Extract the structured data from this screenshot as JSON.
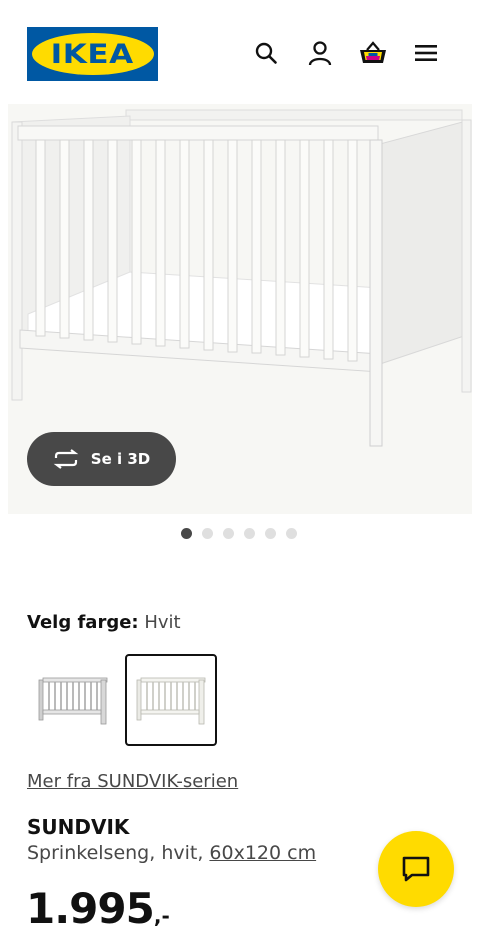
{
  "header": {
    "logo_text": "IKEA",
    "icons": [
      "search-icon",
      "user-icon",
      "basket-icon",
      "menu-icon"
    ]
  },
  "hero": {
    "view_3d_label": "Se i 3D",
    "carousel_total": 6,
    "carousel_active": 1
  },
  "color": {
    "label": "Velg farge:",
    "value": "Hvit"
  },
  "product": {
    "series_link": "Mer fra SUNDVIK-serien",
    "name": "SUNDVIK",
    "description": "Sprinkelseng, hvit,",
    "size": "60x120 cm",
    "price_main": "1.995",
    "price_suffix": ",-"
  },
  "colors": {
    "logo_blue": "#0058a3",
    "logo_yellow": "#ffdb00",
    "chat_yellow": "#ffdb00",
    "dark_button": "#484848"
  }
}
